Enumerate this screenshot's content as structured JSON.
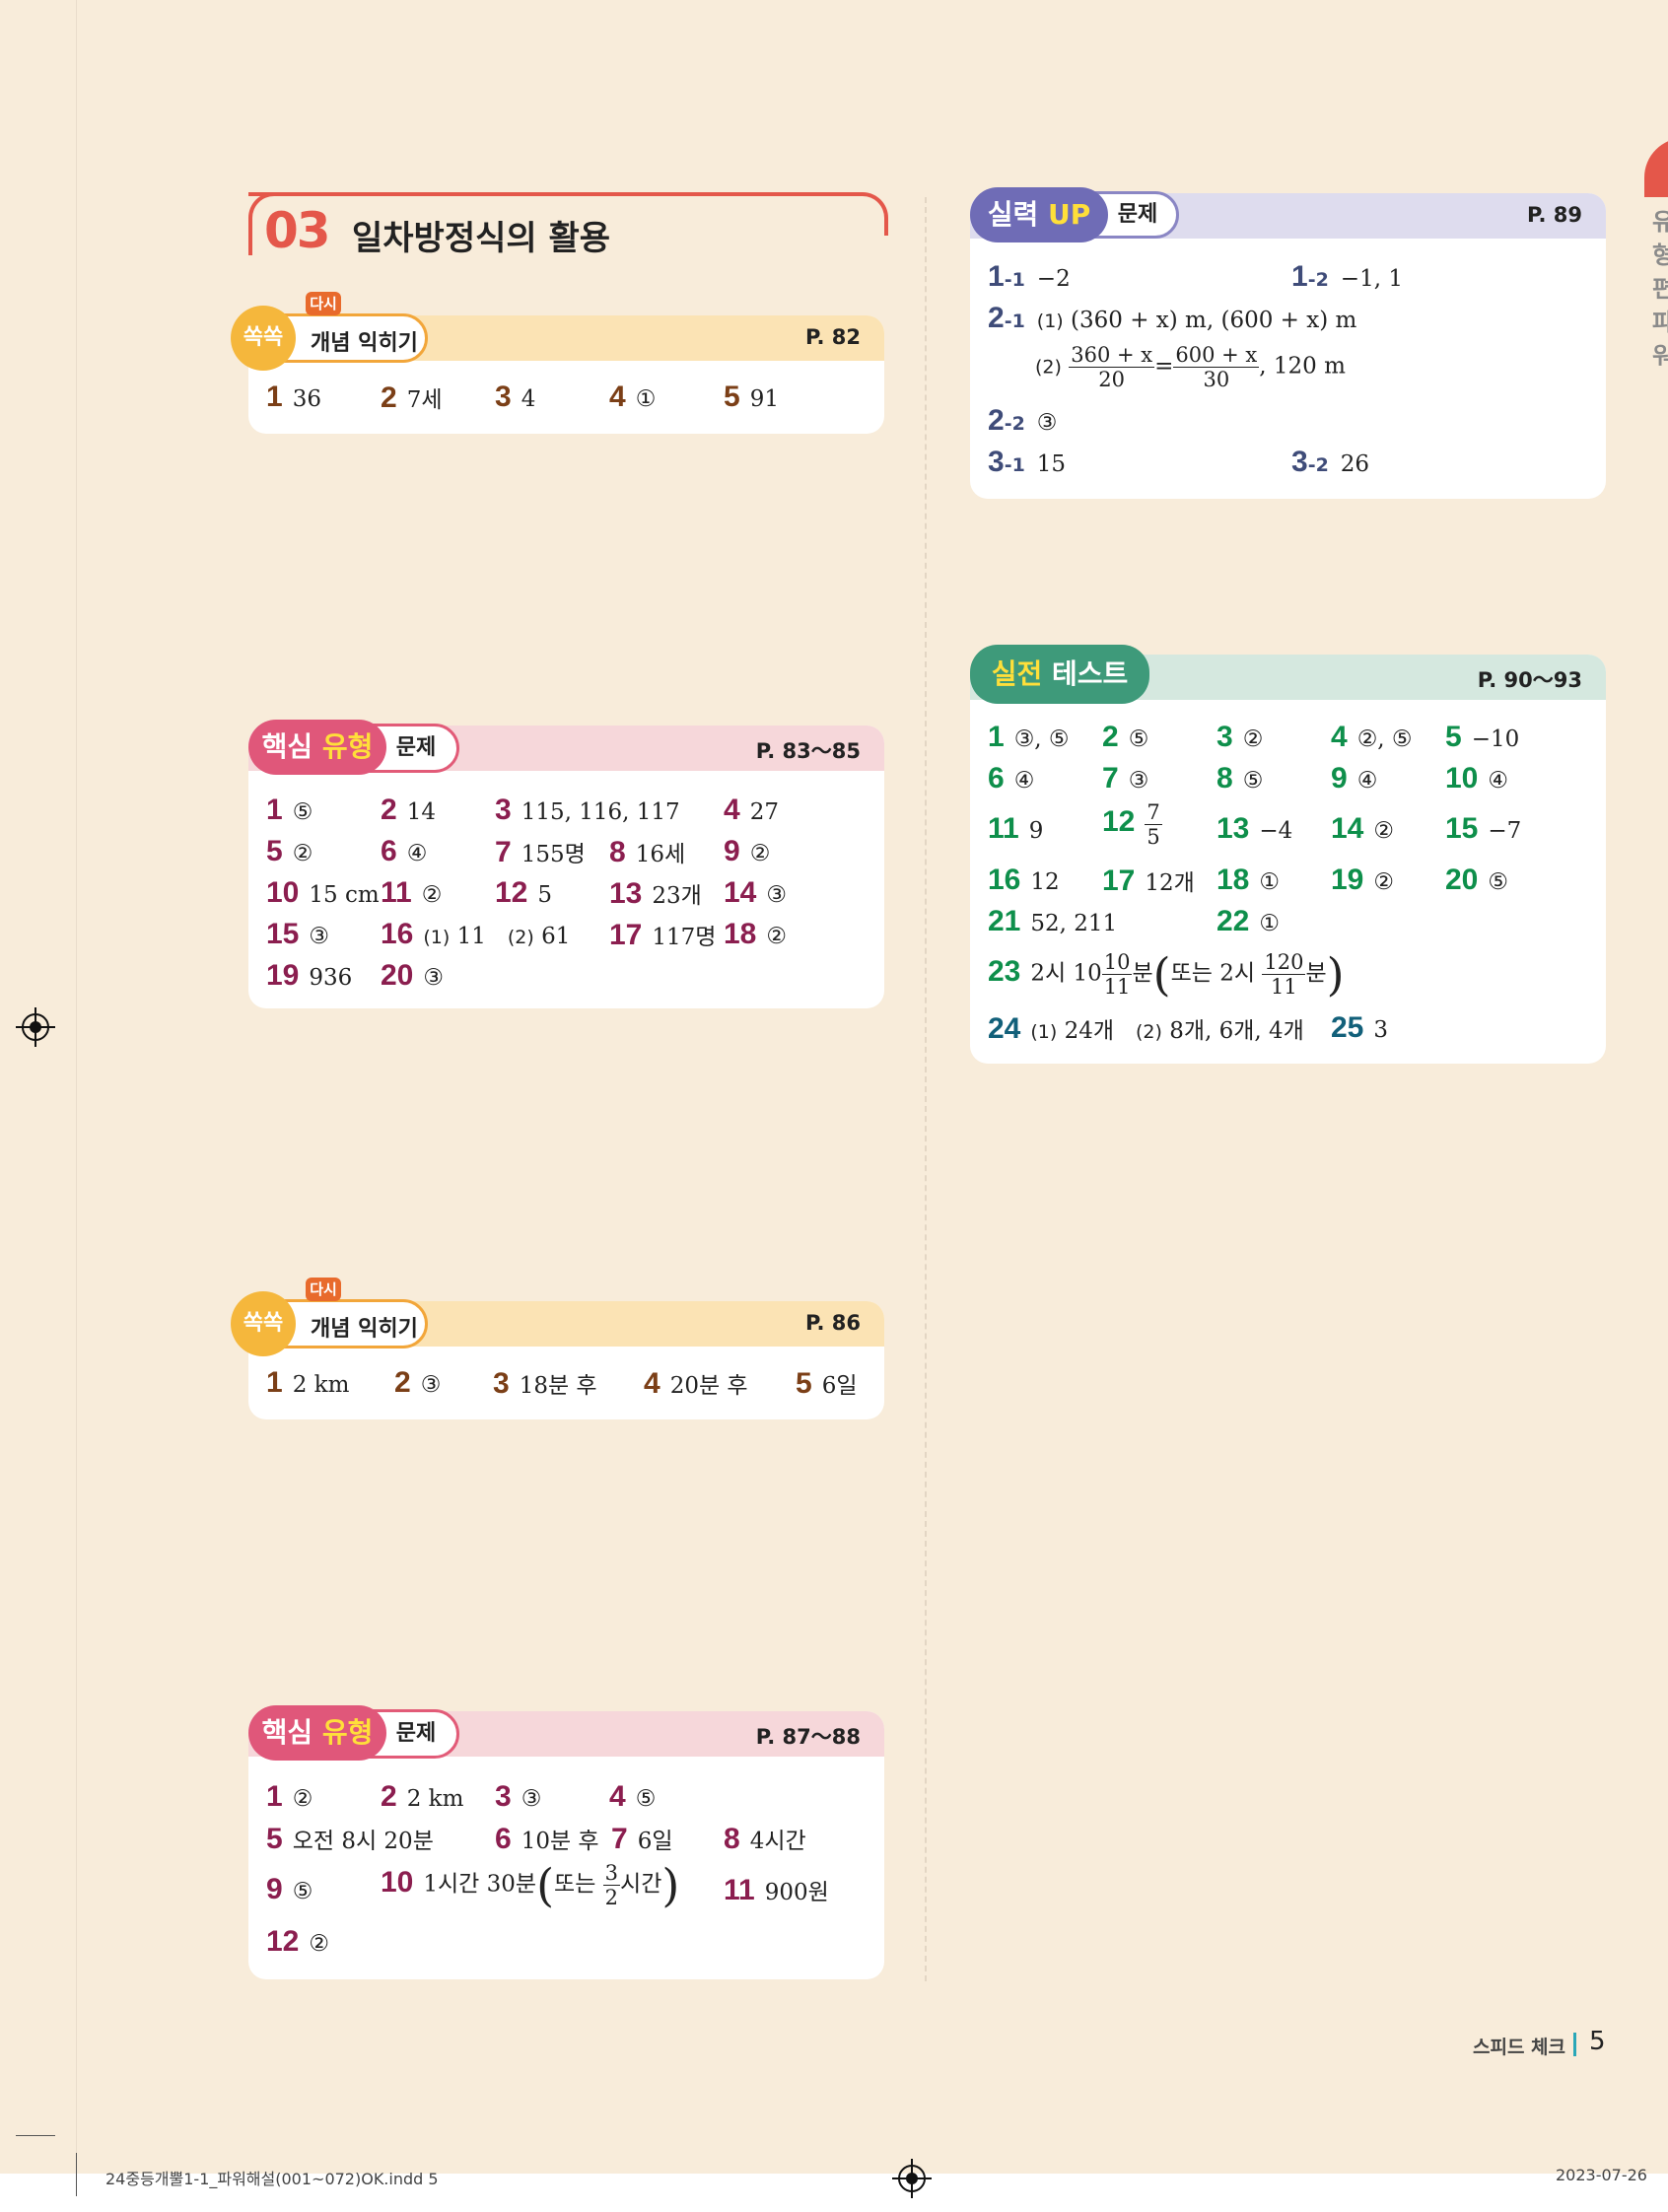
{
  "side_tab": {
    "text": "유형편 파워"
  },
  "chapter": {
    "number": "03",
    "title": "일차방정식의 활용"
  },
  "s1": {
    "dasi": "다시",
    "ssok": "쏙쏙",
    "label": "개념 익히기",
    "page": "P. 82",
    "items": [
      {
        "n": "1",
        "a": "36"
      },
      {
        "n": "2",
        "a": "7세"
      },
      {
        "n": "3",
        "a": "4"
      },
      {
        "n": "4",
        "a": "①"
      },
      {
        "n": "5",
        "a": "91"
      }
    ]
  },
  "s2": {
    "pill1": "핵심",
    "pill2": "유형",
    "label": "문제",
    "page": "P. 83～85",
    "items": [
      {
        "n": "1",
        "a": "⑤"
      },
      {
        "n": "2",
        "a": "14"
      },
      {
        "n": "3",
        "a": "115, 116, 117"
      },
      {
        "n": "4",
        "a": "27"
      },
      {
        "n": "5",
        "a": "②"
      },
      {
        "n": "6",
        "a": "④"
      },
      {
        "n": "7",
        "a": "155명"
      },
      {
        "n": "8",
        "a": "16세"
      },
      {
        "n": "9",
        "a": "②"
      },
      {
        "n": "10",
        "a": "15 cm"
      },
      {
        "n": "11",
        "a": "②"
      },
      {
        "n": "12",
        "a": "5"
      },
      {
        "n": "13",
        "a": "23개"
      },
      {
        "n": "14",
        "a": "③"
      },
      {
        "n": "15",
        "a": "③"
      },
      {
        "n": "16",
        "a1": "(1)",
        "a2": "11",
        "a3": "(2)",
        "a4": "61"
      },
      {
        "n": "17",
        "a": "117명"
      },
      {
        "n": "18",
        "a": "②"
      },
      {
        "n": "19",
        "a": "936"
      },
      {
        "n": "20",
        "a": "③"
      }
    ]
  },
  "s3": {
    "dasi": "다시",
    "ssok": "쏙쏙",
    "label": "개념 익히기",
    "page": "P. 86",
    "items": [
      {
        "n": "1",
        "a": "2 km"
      },
      {
        "n": "2",
        "a": "③"
      },
      {
        "n": "3",
        "a": "18분 후"
      },
      {
        "n": "4",
        "a": "20분 후"
      },
      {
        "n": "5",
        "a": "6일"
      }
    ]
  },
  "s4": {
    "pill1": "핵심",
    "pill2": "유형",
    "label": "문제",
    "page": "P. 87～88",
    "items": [
      {
        "n": "1",
        "a": "②"
      },
      {
        "n": "2",
        "a": "2 km"
      },
      {
        "n": "3",
        "a": "③"
      },
      {
        "n": "4",
        "a": "⑤"
      },
      {
        "n": "5",
        "a": "오전 8시 20분"
      },
      {
        "n": "6",
        "a": "10분 후"
      },
      {
        "n": "7",
        "a": "6일"
      },
      {
        "n": "8",
        "a": "4시간"
      },
      {
        "n": "9",
        "a": "⑤"
      },
      {
        "n": "10",
        "a_pre": "1시간 30분",
        "a_in": "또는",
        "frac_top": "3",
        "frac_bot": "2",
        "a_post": "시간"
      },
      {
        "n": "11",
        "a": "900원"
      },
      {
        "n": "12",
        "a": "②"
      }
    ]
  },
  "s5": {
    "pill1": "실력",
    "pill2": "UP",
    "label": "문제",
    "page": "P. 89",
    "r1": {
      "n1": "1",
      "s1": "-1",
      "a1": "−2",
      "n2": "1",
      "s2": "-2",
      "a2": "−1, 1"
    },
    "r2": {
      "n": "2",
      "s": "-1",
      "p1": "(1)",
      "a1": "(360 + x) m, (600 + x) m",
      "p2": "(2)",
      "f1t": "360 + x",
      "f1b": "20",
      "eq": "=",
      "f2t": "600 + x",
      "f2b": "30",
      "a2": ", 120 m"
    },
    "r3": {
      "n": "2",
      "s": "-2",
      "a": "③"
    },
    "r4": {
      "n1": "3",
      "s1": "-1",
      "a1": "15",
      "n2": "3",
      "s2": "-2",
      "a2": "26"
    }
  },
  "s6": {
    "pill1": "실전",
    "pill2": "테스트",
    "page": "P. 90～93",
    "items": [
      {
        "n": "1",
        "a": "③, ⑤"
      },
      {
        "n": "2",
        "a": "⑤"
      },
      {
        "n": "3",
        "a": "②"
      },
      {
        "n": "4",
        "a": "②, ⑤"
      },
      {
        "n": "5",
        "a": "−10"
      },
      {
        "n": "6",
        "a": "④"
      },
      {
        "n": "7",
        "a": "③"
      },
      {
        "n": "8",
        "a": "⑤"
      },
      {
        "n": "9",
        "a": "④"
      },
      {
        "n": "10",
        "a": "④"
      },
      {
        "n": "11",
        "a": "9"
      },
      {
        "n": "12",
        "frac_top": "7",
        "frac_bot": "5"
      },
      {
        "n": "13",
        "a": "−4"
      },
      {
        "n": "14",
        "a": "②"
      },
      {
        "n": "15",
        "a": "−7"
      },
      {
        "n": "16",
        "a": "12"
      },
      {
        "n": "17",
        "a": "12개"
      },
      {
        "n": "18",
        "a": "①"
      },
      {
        "n": "19",
        "a": "②"
      },
      {
        "n": "20",
        "a": "⑤"
      },
      {
        "n": "21",
        "a": "52, 211"
      },
      {
        "n": "22",
        "a": "①"
      },
      {
        "n": "23",
        "a_pre": "2시 10",
        "f1t": "10",
        "f1b": "11",
        "a_mid": "분",
        "a_in": "또는 2시",
        "f2t": "120",
        "f2b": "11",
        "a_post": "분"
      },
      {
        "n": "24",
        "p1": "(1)",
        "a1": "24개",
        "p2": "(2)",
        "a2": "8개, 6개, 4개"
      },
      {
        "n": "25",
        "a": "3"
      }
    ]
  },
  "footer": {
    "section": "스피드 체크",
    "page": "5",
    "file": "24중등개뿔1-1_파워해설(001~072)OK.indd   5",
    "date": "2023-07-26"
  }
}
